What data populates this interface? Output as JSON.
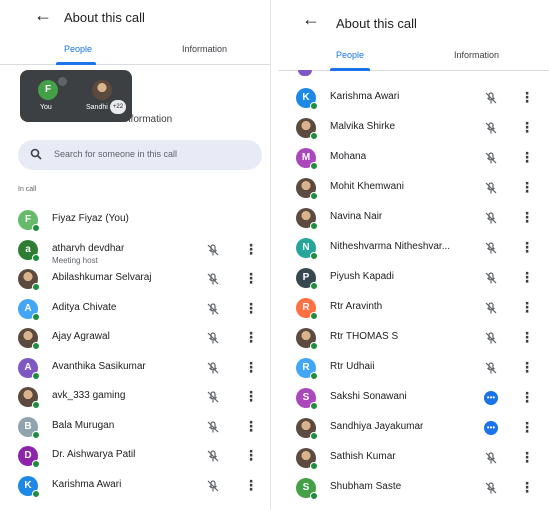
{
  "colors": {
    "accent": "#1a73e8",
    "online": "#1e8e3e",
    "search_bg": "#e8eaf6"
  },
  "left": {
    "header": {
      "title": "About this call"
    },
    "tabs": [
      "People",
      "Information"
    ],
    "active_tab": "People",
    "popup": {
      "items": [
        {
          "initial": "F",
          "label": "You",
          "color": "#43a047"
        },
        {
          "initial": "",
          "label": "Sandhi",
          "color": "photo"
        }
      ],
      "badge": "+22"
    },
    "info_text": "nformation",
    "search": {
      "placeholder": "Search for someone in this call"
    },
    "section_label": "In call",
    "participants": [
      {
        "name": "Fiyaz Fiyaz (You)",
        "initial": "F",
        "color": "#66bb6a"
      },
      {
        "name": "atharvh devdhar",
        "sub": "Meeting host",
        "initial": "a",
        "color": "#2e7d32"
      },
      {
        "name": "Abilashkumar Selvaraj",
        "initial": "",
        "color": "photo"
      },
      {
        "name": "Aditya Chivate",
        "initial": "A",
        "color": "#42a5f5"
      },
      {
        "name": "Ajay Agrawal",
        "initial": "",
        "color": "photo"
      },
      {
        "name": "Avanthika Sasikumar",
        "initial": "A",
        "color": "#7e57c2"
      },
      {
        "name": "avk_333 gaming",
        "initial": "",
        "color": "photo"
      },
      {
        "name": "Bala Murugan",
        "initial": "B",
        "color": "#90a4ae"
      },
      {
        "name": "Dr. Aishwarya Patil",
        "initial": "D",
        "color": "#8e24aa"
      },
      {
        "name": "Karishma Awari",
        "initial": "K",
        "color": "#1e88e5"
      }
    ]
  },
  "right": {
    "header": {
      "title": "About this call"
    },
    "tabs": [
      "People",
      "Information"
    ],
    "active_tab": "People",
    "participants": [
      {
        "name": "Karishma Awari",
        "initial": "K",
        "color": "#1e88e5"
      },
      {
        "name": "Malvika Shirke",
        "initial": "",
        "color": "photo"
      },
      {
        "name": "Mohana",
        "initial": "M",
        "color": "#ab47bc"
      },
      {
        "name": "Mohit Khemwani",
        "initial": "",
        "color": "photo"
      },
      {
        "name": "Navina Nair",
        "initial": "",
        "color": "photo"
      },
      {
        "name": "Nitheshvarma Nitheshvar...",
        "initial": "N",
        "color": "#26a69a"
      },
      {
        "name": "Piyush Kapadi",
        "initial": "P",
        "color": "#37474f"
      },
      {
        "name": "Rtr Aravinth",
        "initial": "R",
        "color": "#ff7043"
      },
      {
        "name": "Rtr THOMAS S",
        "initial": "",
        "color": "photo"
      },
      {
        "name": "Rtr Udhaii",
        "initial": "R",
        "color": "#42a5f5"
      },
      {
        "name": "Sakshi Sonawani",
        "initial": "S",
        "color": "#ab47bc",
        "speaking": true
      },
      {
        "name": "Sandhiya Jayakumar",
        "initial": "",
        "color": "photo",
        "speaking": true
      },
      {
        "name": "Sathish Kumar",
        "initial": "",
        "color": "photo"
      },
      {
        "name": "Shubham Saste",
        "initial": "S",
        "color": "#43a047"
      }
    ]
  }
}
